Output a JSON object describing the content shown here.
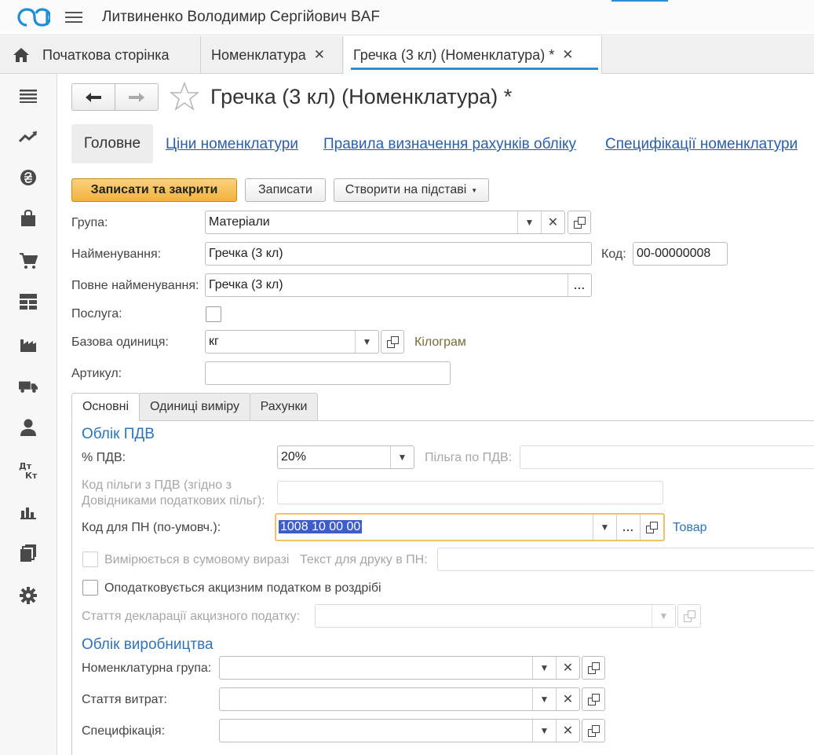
{
  "app": {
    "user_title": "Литвиненко Володимир Сергійович BAF"
  },
  "tabs": {
    "home": "Початкова сторінка",
    "nomenclature": "Номенклатура",
    "current": "Гречка (3 кл) (Номенклатура) *",
    "close_glyph": "✕"
  },
  "doc": {
    "title": "Гречка (3 кл) (Номенклатура) *"
  },
  "sections": {
    "main": "Головне",
    "prices": "Ціни номенклатури",
    "accounts_rules": "Правила визначення рахунків обліку",
    "specs": "Специфікації номенклатури"
  },
  "commands": {
    "save_close": "Записати та закрити",
    "save": "Записати",
    "create_based": "Створити на підставі"
  },
  "form": {
    "group_label": "Група:",
    "group_value": "Матеріали",
    "name_label": "Найменування:",
    "name_value": "Гречка (3 кл)",
    "code_label": "Код:",
    "code_value": "00-00000008",
    "full_name_label": "Повне найменування:",
    "full_name_value": "Гречка (3 кл)",
    "service_label": "Послуга:",
    "base_unit_label": "Базова одиниця:",
    "base_unit_value": "кг",
    "base_unit_hint": "Кілограм",
    "article_label": "Артикул:",
    "article_value": ""
  },
  "inner_tabs": {
    "main": "Основні",
    "units": "Одиниці виміру",
    "accounts": "Рахунки"
  },
  "vat": {
    "group_title": "Облік ПДВ",
    "rate_label": "% ПДВ:",
    "rate_value": "20%",
    "benefit_label": "Пільга по ПДВ:",
    "benefit_code_label_1": "Код пільги з ПДВ (згідно з",
    "benefit_code_label_2": "Довідниками податкових пільг):",
    "pn_code_label": "Код для ПН (по-умовч.):",
    "pn_code_value": "1008 10 00 00",
    "pn_code_hint": "Товар",
    "measured_sum_label": "Вимірюється в сумовому виразі",
    "print_text_label": "Текст для друку в ПН:",
    "excise_label": "Оподатковується акцизним податком в роздрібі",
    "excise_article_label": "Стаття декларації акцизного податку:"
  },
  "production": {
    "group_title": "Облік виробництва",
    "nom_group_label": "Номенклатурна група:",
    "cost_item_label": "Стаття витрат:",
    "spec_label": "Специфікація:"
  },
  "glyphs": {
    "dropdown": "▼",
    "clear": "✕",
    "dots": "...",
    "back": "🡐",
    "fwd": "🡒"
  },
  "colors": {
    "accent": "#2e8fd0",
    "link": "#2a5fa8",
    "group_title": "#2d73bd",
    "hint": "#7a6a3a",
    "primary_button": "#f1b23c"
  }
}
